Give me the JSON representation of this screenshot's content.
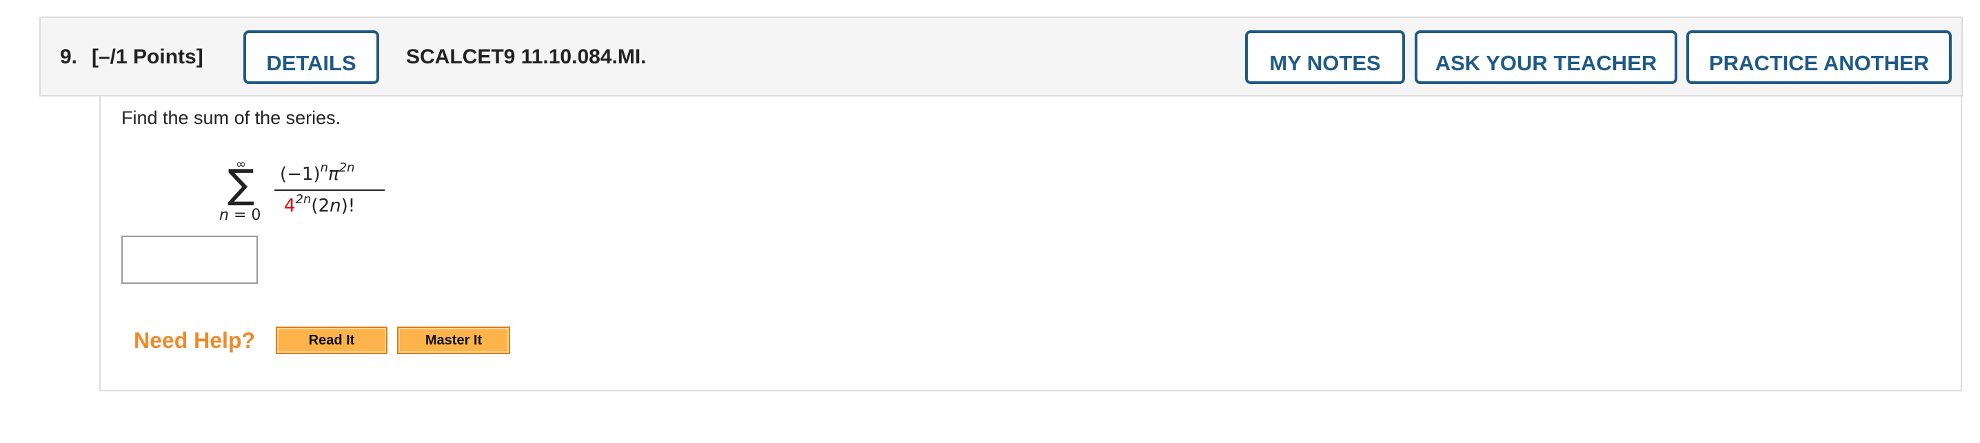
{
  "header": {
    "question_number": "9.",
    "points": "[–/1 Points]",
    "details_label": "DETAILS",
    "question_code": "SCALCET9 11.10.084.MI.",
    "my_notes_label": "MY NOTES",
    "ask_teacher_label": "ASK YOUR TEACHER",
    "practice_another_label": "PRACTICE ANOTHER"
  },
  "body": {
    "prompt": "Find the sum of the series.",
    "series": {
      "sum_symbol": "∑",
      "upper_limit": "∞",
      "lower_var": "n",
      "lower_eq": " = 0",
      "numerator_base": "(−1)",
      "numerator_exp1": "n",
      "numerator_pi": "π",
      "numerator_exp2": "2n",
      "denominator_base": "4",
      "denominator_exp": "2n",
      "denominator_rest_open": "(2",
      "denominator_rest_var": "n",
      "denominator_rest_close": ")!"
    },
    "answer_value": ""
  },
  "help": {
    "label": "Need Help?",
    "read_it_label": "Read It",
    "master_it_label": "Master It"
  },
  "colors": {
    "header_bg": "#f5f5f5",
    "button_blue": "#1f5a86",
    "help_orange": "#ef8a2b",
    "help_button_fill": "#fbb34a",
    "highlight_red": "#e00000"
  }
}
